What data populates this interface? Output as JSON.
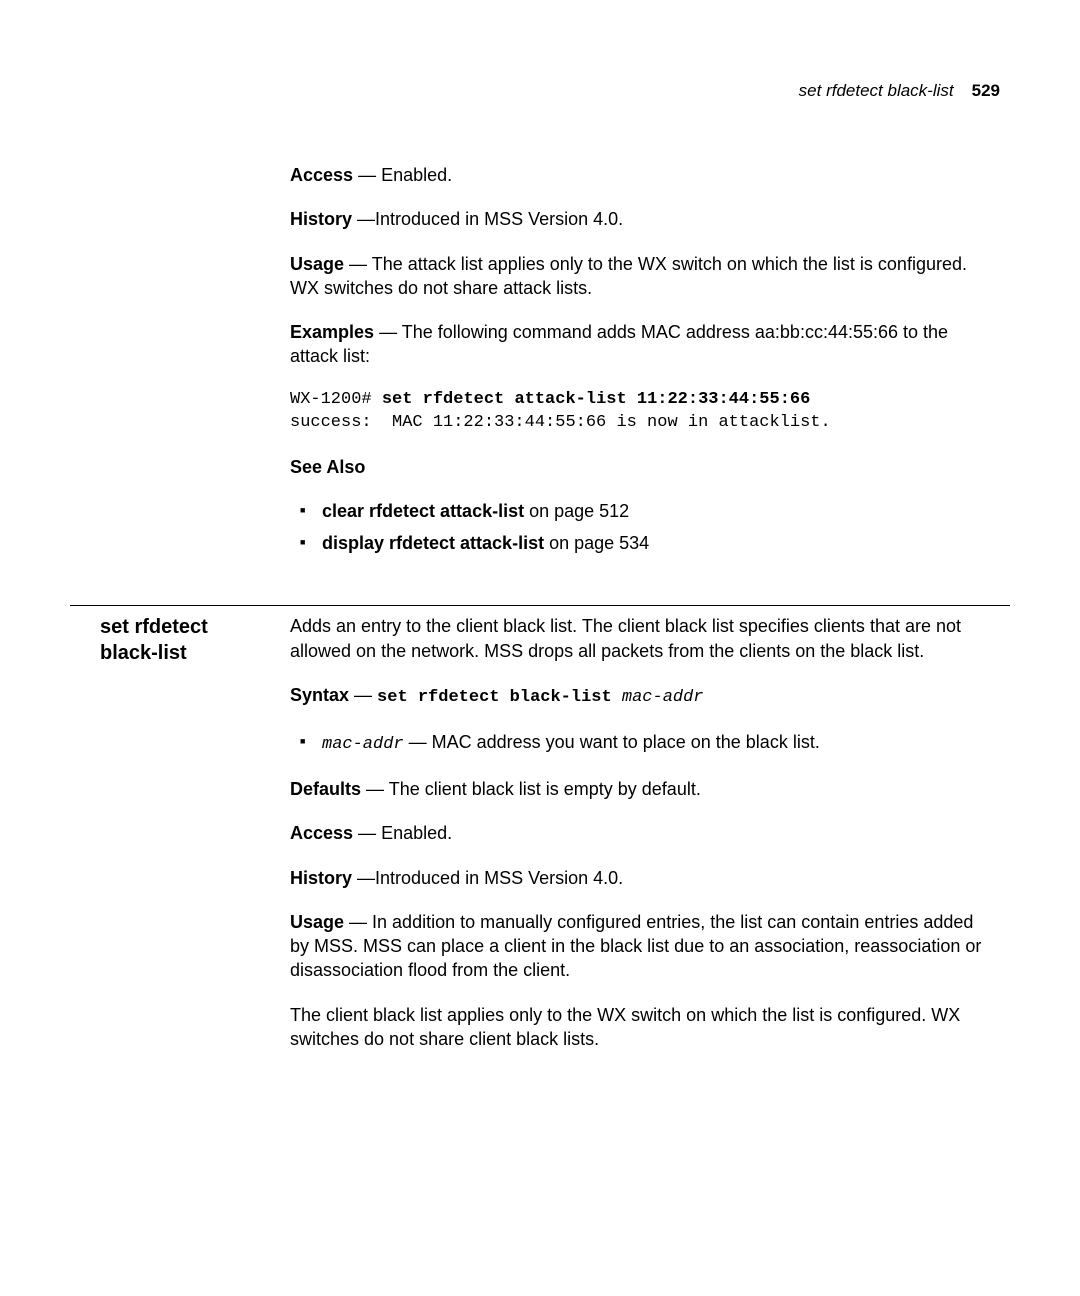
{
  "header": {
    "running_title": "set rfdetect black-list",
    "page_number": "529"
  },
  "upper": {
    "access_label": "Access",
    "access_text": " — Enabled.",
    "history_label": "History",
    "history_text": " —Introduced in MSS Version 4.0.",
    "usage_label": "Usage",
    "usage_text": " — The attack list applies only to the WX switch on which the list is configured. WX switches do not share attack lists.",
    "examples_label": "Examples",
    "examples_text": " — The following command adds MAC address aa:bb:cc:44:55:66 to the attack list:",
    "code_line1_prefix": "WX-1200# ",
    "code_line1_cmd": "set rfdetect attack-list 11:22:33:44:55:66",
    "code_line2": "success:  MAC 11:22:33:44:55:66 is now in attacklist.",
    "see_also_label": "See Also",
    "see_also_item1_bold": "clear rfdetect attack-list",
    "see_also_item1_rest": " on page 512",
    "see_also_item2_bold": "display rfdetect attack-list",
    "see_also_item2_rest": " on page 534"
  },
  "section2": {
    "title_line1": "set rfdetect",
    "title_line2": "black-list",
    "intro": "Adds an entry to the client black list. The client black list specifies clients that are not allowed on the network. MSS drops all packets from the clients on the black list.",
    "syntax_label": "Syntax",
    "syntax_dash": " — ",
    "syntax_cmd": "set rfdetect black-list ",
    "syntax_arg": "mac-addr",
    "bullet_arg": "mac-addr",
    "bullet_text": " — MAC address you want to place on the black list.",
    "defaults_label": "Defaults",
    "defaults_text": " — The client black list is empty by default.",
    "access_label": "Access",
    "access_text": " — Enabled.",
    "history_label": "History",
    "history_text": " —Introduced in MSS Version 4.0.",
    "usage_label": "Usage",
    "usage_text": " — In addition to manually configured entries, the list can contain entries added by MSS. MSS can place a client in the black list due to an association, reassociation or disassociation flood from the client.",
    "para_last": "The client black list applies only to the WX switch on which the list is configured. WX switches do not share client black lists."
  }
}
